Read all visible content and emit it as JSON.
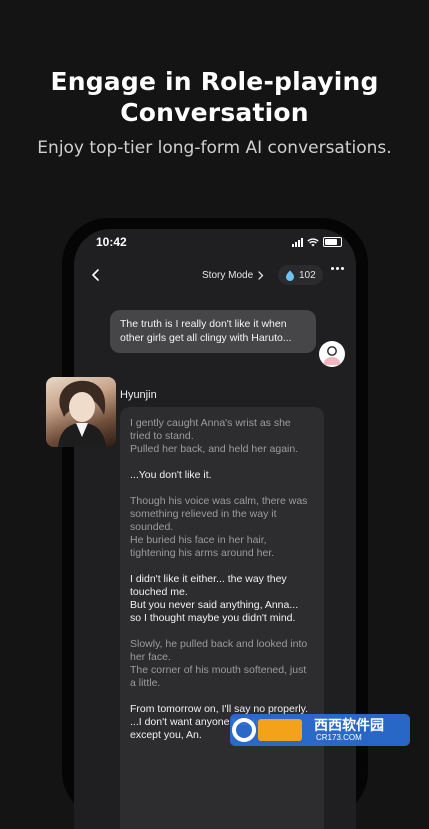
{
  "header": {
    "title_line1": "Engage in Role-playing",
    "title_line2": "Conversation",
    "subtitle": "Enjoy top-tier long-form AI conversations."
  },
  "status_bar": {
    "time": "10:42"
  },
  "toolbar": {
    "mode_label": "Story Mode",
    "coin_count": "102"
  },
  "chat": {
    "user_message": "The truth is I really don't like it when other girls get all clingy with Haruto...",
    "character_name": "Hyunjin",
    "character_message": [
      {
        "kind": "narr",
        "text": "I gently caught Anna's wrist as she tried to stand.\nPulled her back, and held her again."
      },
      {
        "kind": "speech",
        "text": "...You don't like it."
      },
      {
        "kind": "narr",
        "text": "Though his voice was calm, there was something relieved in the way it sounded.\nHe buried his face in her hair, tightening his arms around her."
      },
      {
        "kind": "speech",
        "text": "I didn't like it either... the way they touched me.\nBut you never said anything, Anna...\nso I thought maybe you didn't mind."
      },
      {
        "kind": "narr",
        "text": "Slowly, he pulled back and looked into her face.\n The corner of his mouth softened, just a little."
      },
      {
        "kind": "speech",
        "text": "From tomorrow on, I'll say no properly.\n ...I don't want anyone touching me except you, An."
      }
    ]
  },
  "watermark": {
    "brand": "西西软件园",
    "url": "CR173.COM"
  },
  "colors": {
    "background": "#141414",
    "accent_coin": "#6ec3f0",
    "bubble_user": "#464649",
    "bubble_char": "#2d2d30"
  }
}
